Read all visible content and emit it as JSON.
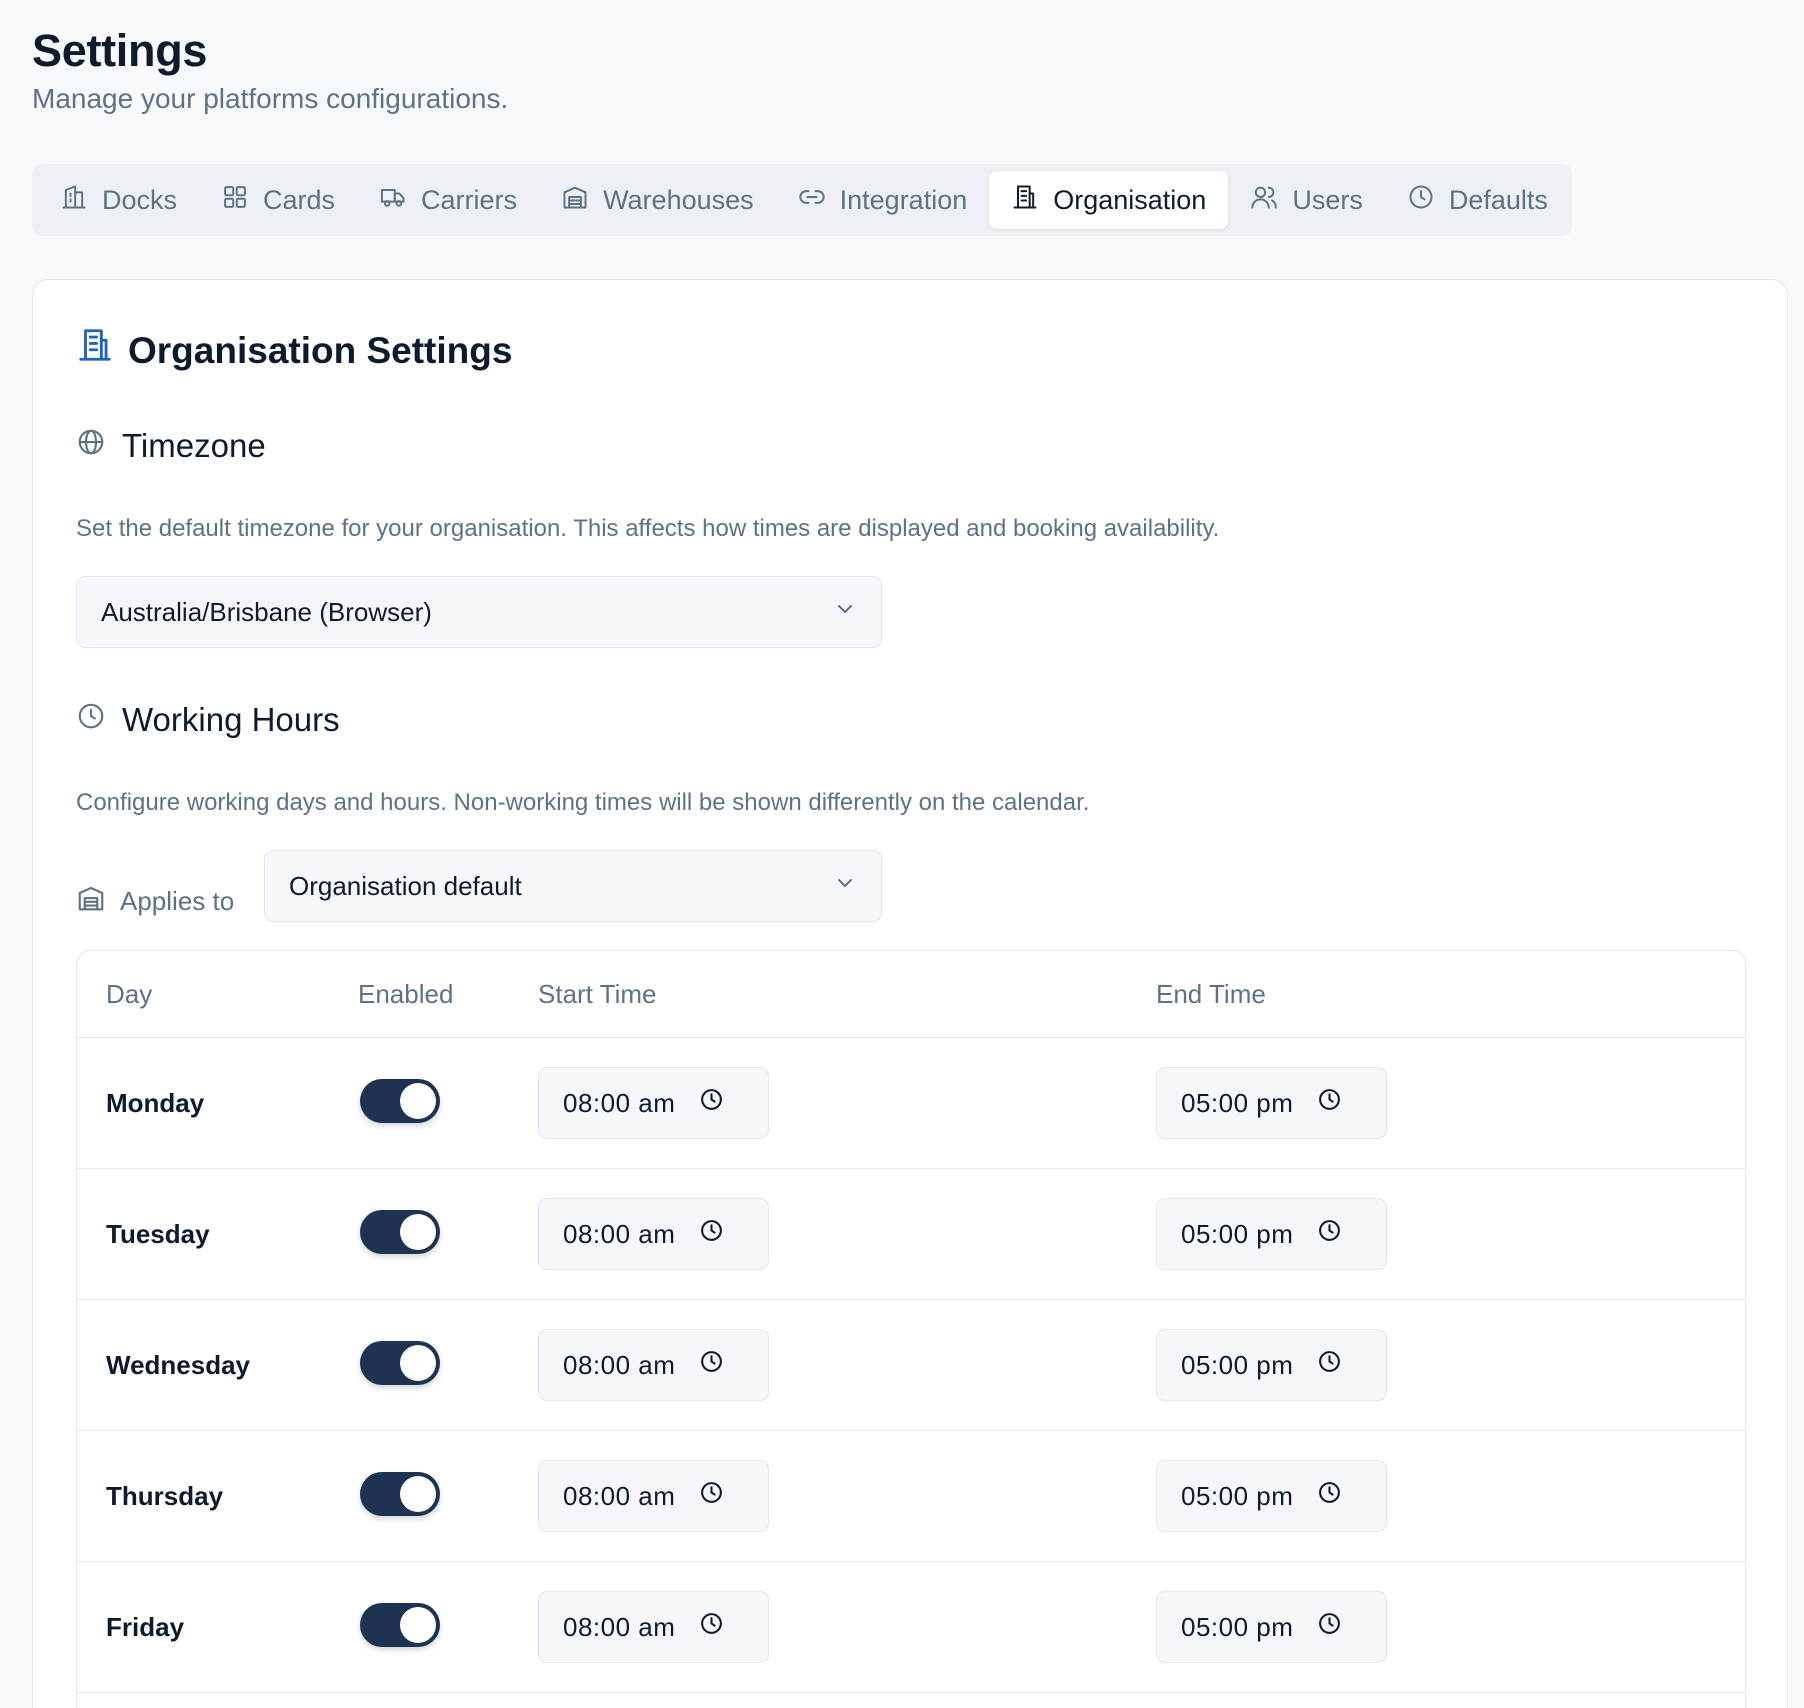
{
  "header": {
    "title": "Settings",
    "subtitle": "Manage your platforms configurations."
  },
  "tabs": [
    {
      "label": "Docks",
      "icon": "dock-icon",
      "active": false
    },
    {
      "label": "Cards",
      "icon": "grid-icon",
      "active": false
    },
    {
      "label": "Carriers",
      "icon": "truck-icon",
      "active": false
    },
    {
      "label": "Warehouses",
      "icon": "warehouse-icon",
      "active": false
    },
    {
      "label": "Integration",
      "icon": "link-icon",
      "active": false
    },
    {
      "label": "Organisation",
      "icon": "building-icon",
      "active": true
    },
    {
      "label": "Users",
      "icon": "users-icon",
      "active": false
    },
    {
      "label": "Defaults",
      "icon": "clock-icon",
      "active": false
    }
  ],
  "card": {
    "title": "Organisation Settings",
    "title_icon": "building-icon"
  },
  "timezone": {
    "heading": "Timezone",
    "icon": "globe-icon",
    "description": "Set the default timezone for your organisation. This affects how times are displayed and booking availability.",
    "selected": "Australia/Brisbane (Browser)"
  },
  "working_hours": {
    "heading": "Working Hours",
    "icon": "clock-icon",
    "description": "Configure working days and hours. Non-working times will be shown differently on the calendar.",
    "applies_label": "Applies to",
    "applies_selected": "Organisation default",
    "columns": {
      "day": "Day",
      "enabled": "Enabled",
      "start": "Start Time",
      "end": "End Time"
    },
    "rows": [
      {
        "day": "Monday",
        "enabled": true,
        "start": "08:00 am",
        "end": "05:00 pm"
      },
      {
        "day": "Tuesday",
        "enabled": true,
        "start": "08:00 am",
        "end": "05:00 pm"
      },
      {
        "day": "Wednesday",
        "enabled": true,
        "start": "08:00 am",
        "end": "05:00 pm"
      },
      {
        "day": "Thursday",
        "enabled": true,
        "start": "08:00 am",
        "end": "05:00 pm"
      },
      {
        "day": "Friday",
        "enabled": true,
        "start": "08:00 am",
        "end": "05:00 pm"
      }
    ]
  },
  "colors": {
    "accent": "#1e63c4",
    "toggle_on": "#1e3352",
    "text_primary": "#0f1b2d",
    "text_muted": "#5f7285"
  }
}
